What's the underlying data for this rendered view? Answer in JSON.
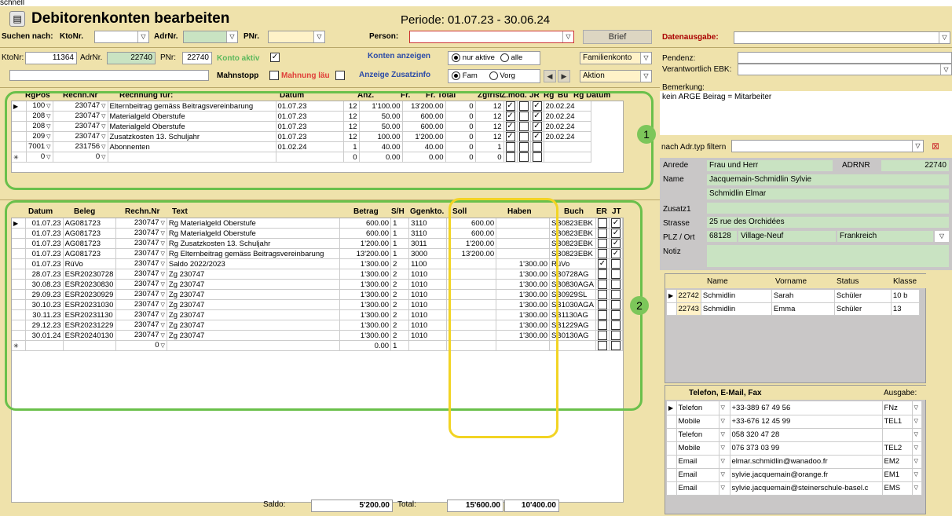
{
  "top_text": "schnell",
  "header": {
    "title": "Debitorenkonten bearbeiten",
    "periode": "Periode: 01.07.23 - 30.06.24",
    "suchen_label": "Suchen nach:",
    "ktonr_label": "KtoNr.",
    "adrnr_label": "AdrNr.",
    "pnr_label": "PNr.",
    "person_label": "Person:",
    "brief_button": "Brief",
    "datenausgabe_label": "Datenausgabe:"
  },
  "account": {
    "ktonr_label": "KtoNr:",
    "ktonr": "11364",
    "adrnr_label": "AdrNr.",
    "adrnr": "22740",
    "pnr_label": "PNr:",
    "pnr": "22740",
    "konto_aktiv": "Konto aktiv",
    "mahnstopp": "Mahnstopp",
    "mahnung": "Mahnung läu",
    "konten_anzeigen": "Konten anzeigen",
    "nur_aktive": "nur aktive",
    "alle": "alle",
    "anzeige_zusatzinfo": "Anzeige Zusatzinfo",
    "fam": "Fam",
    "vorg": "Vorg",
    "familienkonto": "Familienkonto",
    "aktion": "Aktion"
  },
  "pendenz": {
    "pendenz_label": "Pendenz:",
    "ebk_label": "Verantwortlich EBK:",
    "bemerkung_label": "Bemerkung:",
    "bemerkung_text": "kein ARGE Beirag = Mitarbeiter"
  },
  "invoices": {
    "headers": [
      "RgPos",
      "Rechn.Nr",
      "Rechnung für:",
      "Datum",
      "Anz.",
      "Fr.",
      "Fr. Total",
      "Zgfrist",
      "Z.mod.",
      "JR",
      "Rg",
      "Bu",
      "Rg Datum"
    ],
    "rows": [
      [
        "100",
        "230747",
        "Elternbeitrag gemäss Beitragsvereinbarung",
        "01.07.23",
        "12",
        "1'100.00",
        "13'200.00",
        "0",
        "12",
        "x",
        "",
        "x",
        "20.02.24"
      ],
      [
        "208",
        "230747",
        "Materialgeld Oberstufe",
        "01.07.23",
        "12",
        "50.00",
        "600.00",
        "0",
        "12",
        "x",
        "",
        "x",
        "20.02.24"
      ],
      [
        "208",
        "230747",
        "Materialgeld Oberstufe",
        "01.07.23",
        "12",
        "50.00",
        "600.00",
        "0",
        "12",
        "x",
        "",
        "x",
        "20.02.24"
      ],
      [
        "209",
        "230747",
        "Zusatzkosten 13. Schuljahr",
        "01.07.23",
        "12",
        "100.00",
        "1'200.00",
        "0",
        "12",
        "x",
        "",
        "x",
        "20.02.24"
      ],
      [
        "7001",
        "231756",
        "Abonnenten",
        "01.02.24",
        "1",
        "40.00",
        "40.00",
        "0",
        "1",
        "",
        "",
        "",
        ""
      ],
      [
        "0",
        "0",
        "",
        "",
        "0",
        "0.00",
        "0.00",
        "0",
        "0",
        "",
        "",
        "",
        ""
      ]
    ]
  },
  "bookings": {
    "headers": [
      "Datum",
      "Beleg",
      "Rechn.Nr",
      "Text",
      "Betrag",
      "S/H",
      "Ggenkto.",
      "Soll",
      "Haben",
      "Buch",
      "ER",
      "JT"
    ],
    "rows": [
      [
        "01.07.23",
        "AG081723",
        "230747",
        "Rg Materialgeld Oberstufe",
        "600.00",
        "1",
        "3110",
        "600.00",
        "",
        "SB0823EBK",
        "",
        "x"
      ],
      [
        "01.07.23",
        "AG081723",
        "230747",
        "Rg Materialgeld Oberstufe",
        "600.00",
        "1",
        "3110",
        "600.00",
        "",
        "SB0823EBK",
        "",
        "x"
      ],
      [
        "01.07.23",
        "AG081723",
        "230747",
        "Rg Zusatzkosten 13. Schuljahr",
        "1'200.00",
        "1",
        "3011",
        "1'200.00",
        "",
        "SB0823EBK",
        "",
        "x"
      ],
      [
        "01.07.23",
        "AG081723",
        "230747",
        "Rg Elternbeitrag gemäss Beitragsvereinbarung",
        "13'200.00",
        "1",
        "3000",
        "13'200.00",
        "",
        "SB0823EBK",
        "",
        "x"
      ],
      [
        "01.07.23",
        "RüVo",
        "230747",
        "Saldo  2022/2023",
        "1'300.00",
        "2",
        "1100",
        "",
        "1'300.00",
        "RüVo",
        "x",
        ""
      ],
      [
        "28.07.23",
        "ESR20230728",
        "230747",
        "Zg 230747",
        "1'300.00",
        "2",
        "1010",
        "",
        "1'300.00",
        "SB0728AG",
        "",
        ""
      ],
      [
        "30.08.23",
        "ESR20230830",
        "230747",
        "Zg 230747",
        "1'300.00",
        "2",
        "1010",
        "",
        "1'300.00",
        "SB0830AGA",
        "",
        ""
      ],
      [
        "29.09.23",
        "ESR20230929",
        "230747",
        "Zg 230747",
        "1'300.00",
        "2",
        "1010",
        "",
        "1'300.00",
        "SB0929SL",
        "",
        ""
      ],
      [
        "30.10.23",
        "ESR20231030",
        "230747",
        "Zg 230747",
        "1'300.00",
        "2",
        "1010",
        "",
        "1'300.00",
        "SB1030AGA",
        "",
        ""
      ],
      [
        "30.11.23",
        "ESR20231130",
        "230747",
        "Zg 230747",
        "1'300.00",
        "2",
        "1010",
        "",
        "1'300.00",
        "SB1130AG",
        "",
        ""
      ],
      [
        "29.12.23",
        "ESR20231229",
        "230747",
        "Zg 230747",
        "1'300.00",
        "2",
        "1010",
        "",
        "1'300.00",
        "SB1229AG",
        "",
        ""
      ],
      [
        "30.01.24",
        "ESR20240130",
        "230747",
        "Zg 230747",
        "1'300.00",
        "2",
        "1010",
        "",
        "1'300.00",
        "SB0130AG",
        "",
        ""
      ],
      [
        "",
        "",
        "0",
        "",
        "0.00",
        "1",
        "",
        "",
        "",
        "",
        "",
        ""
      ]
    ],
    "saldo_label": "Saldo:",
    "saldo": "5'200.00",
    "total_label": "Total:",
    "total_soll": "15'600.00",
    "total_haben": "10'400.00"
  },
  "address": {
    "filter_label": "nach Adr.typ filtern",
    "anrede_label": "Anrede",
    "anrede": "Frau und Herr",
    "adrnr_label": "ADRNR",
    "adrnr": "22740",
    "name_label": "Name",
    "name1": "Jacquemain-Schmidlin Sylvie",
    "name2": "Schmidlin Elmar",
    "zusatz_label": "Zusatz1",
    "strasse_label": "Strasse",
    "strasse": "25 rue des Orchidées",
    "plz_label": "PLZ / Ort",
    "plz": "68128",
    "ort": "Village-Neuf",
    "land": "Frankreich",
    "notiz_label": "Notiz"
  },
  "children": {
    "headers": [
      "Name",
      "Vorname",
      "Status",
      "Klasse"
    ],
    "rows": [
      [
        "22742",
        "Schmidlin",
        "Sarah",
        "Schüler",
        "10 b"
      ],
      [
        "22743",
        "Schmidlin",
        "Emma",
        "Schüler",
        "13"
      ]
    ]
  },
  "contacts": {
    "title": "Telefon, E-Mail, Fax",
    "ausgabe_label": "Ausgabe:",
    "rows": [
      [
        "Telefon",
        "+33-389 67 49 56",
        "FNz"
      ],
      [
        "Mobile",
        "+33-676 12 45 99",
        "TEL1"
      ],
      [
        "Telefon",
        "058 320 47 28",
        ""
      ],
      [
        "Mobile",
        "076 373 03 99",
        "TEL2"
      ],
      [
        "Email",
        "elmar.schmidlin@wanadoo.fr",
        "EM2"
      ],
      [
        "Email",
        "sylvie.jacquemain@orange.fr",
        "EM1"
      ],
      [
        "Email",
        "sylvie.jacquemain@steinerschule-basel.c",
        "EMS"
      ]
    ]
  },
  "annotations": {
    "badge1": "1",
    "badge2": "2"
  }
}
